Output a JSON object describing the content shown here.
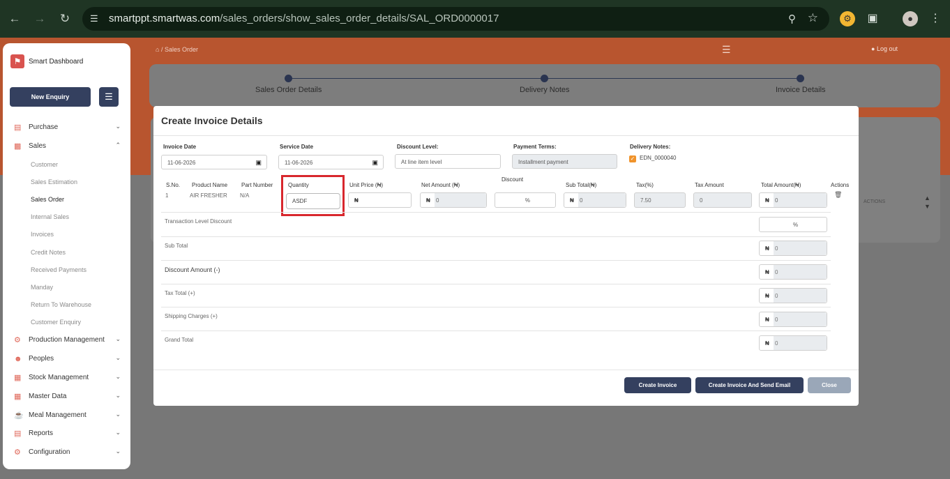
{
  "browser": {
    "url_host": "smartppt.smartwas.com",
    "url_path": "/sales_orders/show_sales_order_details/SAL_ORD0000017"
  },
  "sidebar": {
    "brand": "Smart Dashboard",
    "new_enquiry": "New Enquiry",
    "items": [
      {
        "label": "Purchase",
        "icon": "cart-icon"
      },
      {
        "label": "Sales",
        "icon": "sales-icon"
      }
    ],
    "sales_sub": [
      "Customer",
      "Sales Estimation",
      "Sales Order",
      "Internal Sales",
      "Invoices",
      "Credit Notes",
      "Received Payments",
      "Manday",
      "Return To Warehouse",
      "Customer Enquiry"
    ],
    "items_after": [
      {
        "label": "Production Management"
      },
      {
        "label": "Peoples"
      },
      {
        "label": "Stock Management"
      },
      {
        "label": "Master Data"
      },
      {
        "label": "Meal Management"
      },
      {
        "label": "Reports"
      },
      {
        "label": "Configuration"
      }
    ]
  },
  "topbar": {
    "breadcrumb": "Sales Order",
    "logout": "Log out"
  },
  "stepper": {
    "steps": [
      "Sales Order Details",
      "Delivery Notes",
      "Invoice Details"
    ]
  },
  "background": {
    "actions_header": "ACTIONS"
  },
  "modal": {
    "title": "Create Invoice Details",
    "invoice_date_label": "Invoice Date",
    "invoice_date": "11-06-2026",
    "service_date_label": "Service Date",
    "service_date": "11-06-2026",
    "discount_level_label": "Discount Level:",
    "discount_level": "At line item level",
    "payment_terms_label": "Payment Terms:",
    "payment_terms": "Installment payment",
    "delivery_notes_label": "Delivery Notes:",
    "delivery_note": "EDN_0000040",
    "table": {
      "headers": {
        "sno": "S.No.",
        "product": "Product Name",
        "part": "Part Number",
        "qty": "Quantity",
        "unit_price": "Unit Price (₦)",
        "net_amount": "Net Amount (₦)",
        "discount": "Discount",
        "sub_total": "Sub Total(₦)",
        "tax_pct": "Tax(%)",
        "tax_amount": "Tax Amount",
        "total_amount": "Total Amount(₦)",
        "actions": "Actions"
      },
      "row": {
        "sno": "1",
        "product": "AIR FRESHER",
        "part": "N/A",
        "qty": "ASDF",
        "currency": "₦",
        "net_amount": "0",
        "discount_unit": "%",
        "sub_total": "0",
        "tax_pct": "7.50",
        "tax_amount": "0",
        "total_amount": "0"
      }
    },
    "summary": {
      "transaction_discount": "Transaction Level Discount",
      "transaction_discount_unit": "%",
      "sub_total": "Sub Total",
      "sub_total_value": "0",
      "discount_amount": "Discount Amount (-)",
      "discount_amount_value": "0",
      "tax_total": "Tax Total (+)",
      "tax_total_value": "0",
      "shipping": "Shipping Charges (+)",
      "shipping_value": "0",
      "grand_total": "Grand Total",
      "grand_total_value": "0",
      "currency": "₦"
    },
    "buttons": {
      "create_invoice": "Create Invoice",
      "create_send": "Create Invoice And Send Email",
      "close": "Close"
    }
  },
  "colors": {
    "brand_orange": "#b8552f",
    "navy": "#34405f",
    "highlight_red": "#d8272d"
  }
}
